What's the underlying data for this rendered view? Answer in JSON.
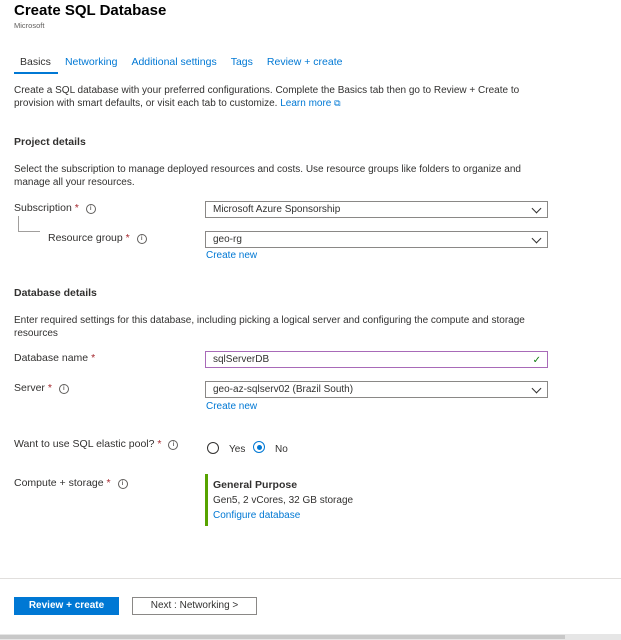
{
  "header": {
    "title": "Create SQL Database",
    "publisher": "Microsoft"
  },
  "tabs": [
    {
      "label": "Basics"
    },
    {
      "label": "Networking"
    },
    {
      "label": "Additional settings"
    },
    {
      "label": "Tags"
    },
    {
      "label": "Review + create"
    }
  ],
  "intro": {
    "text": "Create a SQL database with your preferred configurations. Complete the Basics tab then go to Review + Create to provision with smart defaults, or visit each tab to customize.",
    "link": "Learn more"
  },
  "project": {
    "heading": "Project details",
    "description": "Select the subscription to manage deployed resources and costs. Use resource groups like folders to organize and manage all your resources.",
    "subscription_label": "Subscription",
    "subscription_value": "Microsoft Azure Sponsorship",
    "resource_group_label": "Resource group",
    "resource_group_value": "geo-rg",
    "create_new": "Create new"
  },
  "database": {
    "heading": "Database details",
    "description": "Enter required settings for this database, including picking a logical server and configuring the compute and storage resources",
    "name_label": "Database name",
    "name_value": "sqlServerDB",
    "server_label": "Server",
    "server_value": "geo-az-sqlserv02 (Brazil South)",
    "create_new": "Create new",
    "elastic_label": "Want to use SQL elastic pool?",
    "elastic_yes": "Yes",
    "elastic_no": "No",
    "elastic_selected": "No",
    "compute_label": "Compute + storage",
    "compute_tier": "General Purpose",
    "compute_detail": "Gen5, 2 vCores, 32 GB storage",
    "compute_link": "Configure database"
  },
  "footer": {
    "review_button": "Review + create",
    "next_button": "Next : Networking >"
  },
  "symbols": {
    "required": "*",
    "info": "i",
    "check": "✓",
    "external": "⧉"
  },
  "colors": {
    "accent": "#0078d4",
    "required": "#a4262c",
    "valid": "#107c10",
    "compute_bar": "#57a300"
  }
}
